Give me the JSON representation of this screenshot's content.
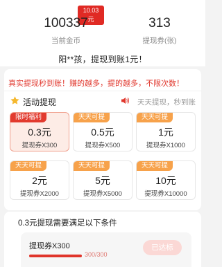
{
  "header": {
    "gold": {
      "badge": "10.03元",
      "value": "100337",
      "label": "当前金币"
    },
    "coupon": {
      "value": "313",
      "label": "提现券(张)"
    },
    "ticker": "阳**孩，提现到账1元！"
  },
  "main": {
    "notice": "真实提现秒到账！赚的越多，提的越多，不限次数！",
    "section_title": "活动提现",
    "section_sub": "天天提现，秒到账",
    "icons": {
      "star": "star-icon",
      "speaker": "speaker-icon"
    },
    "tiles": [
      {
        "tag": "限时福利",
        "amount": "0.3元",
        "sub": "提现券X300",
        "selected": true
      },
      {
        "tag": "天天可提",
        "amount": "0.5元",
        "sub": "提现券X500",
        "selected": false
      },
      {
        "tag": "天天可提",
        "amount": "1元",
        "sub": "提现券X1000",
        "selected": false
      },
      {
        "tag": "天天可提",
        "amount": "2元",
        "sub": "提现券X2000",
        "selected": false
      },
      {
        "tag": "天天可提",
        "amount": "5元",
        "sub": "提现券X5000",
        "selected": false
      },
      {
        "tag": "天天可提",
        "amount": "10元",
        "sub": "提现券X10000",
        "selected": false
      }
    ]
  },
  "condition": {
    "title": "0.3元提现需要满足以下条件",
    "name": "提现券X300",
    "progress_text": "300/300",
    "progress_fraction": 1.0,
    "button_label": "已达标"
  },
  "colors": {
    "accent": "#e0352b",
    "tag": "#f7a24b",
    "selected_bg": "#fdece6"
  }
}
